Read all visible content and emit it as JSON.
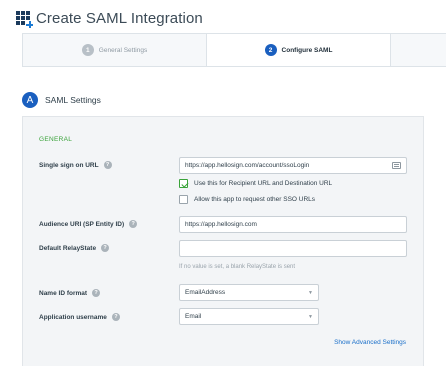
{
  "header": {
    "title": "Create SAML Integration",
    "icon": "app-grid-plus-icon"
  },
  "wizard": {
    "steps": [
      {
        "number": "1",
        "label": "General Settings",
        "state": "complete"
      },
      {
        "number": "2",
        "label": "Configure SAML",
        "state": "active"
      }
    ]
  },
  "section": {
    "badge": "A",
    "title": "SAML Settings"
  },
  "form": {
    "group_label": "GENERAL",
    "sso_url": {
      "label": "Single sign on URL",
      "value": "https://app.hellosign.com/account/ssoLogin"
    },
    "recipient_checkbox": {
      "label": "Use this for Recipient URL and Destination URL",
      "checked": true
    },
    "other_sso_checkbox": {
      "label": "Allow this app to request other SSO URLs",
      "checked": false
    },
    "audience_uri": {
      "label": "Audience URI (SP Entity ID)",
      "value": "https://app.hellosign.com"
    },
    "relay_state": {
      "label": "Default RelayState",
      "value": "",
      "hint": "If no value is set, a blank RelayState is sent"
    },
    "name_id_format": {
      "label": "Name ID format",
      "value": "EmailAddress"
    },
    "app_username": {
      "label": "Application username",
      "value": "Email"
    },
    "advanced_link": "Show Advanced Settings"
  },
  "colors": {
    "accent_blue": "#1a5fbf",
    "group_green": "#3aa33a",
    "link_blue": "#1a6fc9"
  }
}
